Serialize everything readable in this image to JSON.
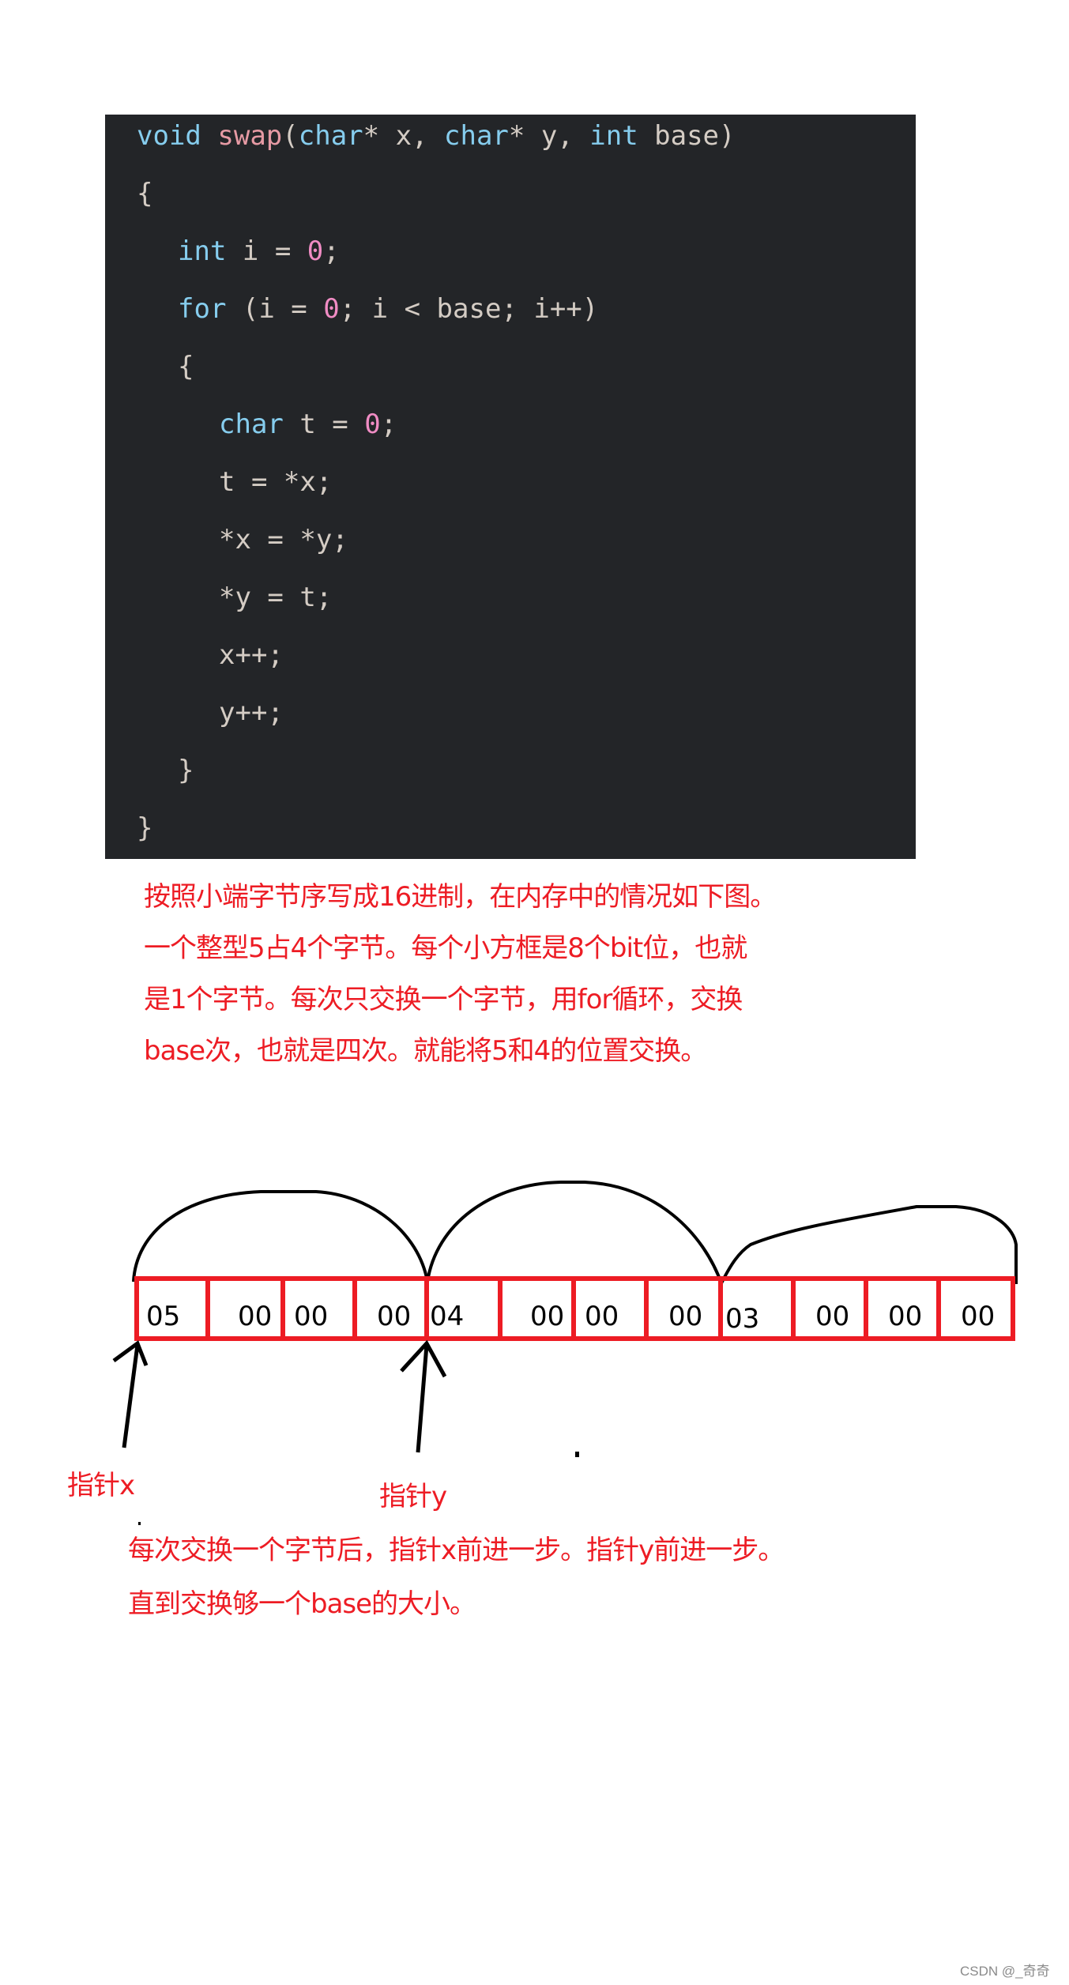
{
  "code": {
    "lines": [
      {
        "indent": 0,
        "tokens": [
          {
            "t": "void",
            "k": "kw"
          },
          {
            "t": " ",
            "k": "plain"
          },
          {
            "t": "swap",
            "k": "fn"
          },
          {
            "t": "(",
            "k": "plain"
          },
          {
            "t": "char",
            "k": "kw"
          },
          {
            "t": "* x, ",
            "k": "plain"
          },
          {
            "t": "char",
            "k": "kw"
          },
          {
            "t": "* y, ",
            "k": "plain"
          },
          {
            "t": "int",
            "k": "kw"
          },
          {
            "t": " base)",
            "k": "plain"
          }
        ]
      },
      {
        "indent": 0,
        "tokens": [
          {
            "t": "{",
            "k": "plain"
          }
        ]
      },
      {
        "indent": 1,
        "tokens": [
          {
            "t": "int",
            "k": "kw"
          },
          {
            "t": " i = ",
            "k": "plain"
          },
          {
            "t": "0",
            "k": "num"
          },
          {
            "t": ";",
            "k": "plain"
          }
        ]
      },
      {
        "indent": 1,
        "tokens": [
          {
            "t": "for",
            "k": "kw"
          },
          {
            "t": " (i = ",
            "k": "plain"
          },
          {
            "t": "0",
            "k": "num"
          },
          {
            "t": "; i < base; i++)",
            "k": "plain"
          }
        ]
      },
      {
        "indent": 1,
        "tokens": [
          {
            "t": "{",
            "k": "plain"
          }
        ]
      },
      {
        "indent": 2,
        "tokens": [
          {
            "t": "char",
            "k": "kw"
          },
          {
            "t": " t = ",
            "k": "plain"
          },
          {
            "t": "0",
            "k": "num"
          },
          {
            "t": ";",
            "k": "plain"
          }
        ]
      },
      {
        "indent": 2,
        "tokens": [
          {
            "t": "t = *x;",
            "k": "plain"
          }
        ]
      },
      {
        "indent": 2,
        "tokens": [
          {
            "t": "*x = *y;",
            "k": "plain"
          }
        ]
      },
      {
        "indent": 2,
        "tokens": [
          {
            "t": "*y = t;",
            "k": "plain"
          }
        ]
      },
      {
        "indent": 2,
        "tokens": [
          {
            "t": "x++;",
            "k": "plain"
          }
        ]
      },
      {
        "indent": 2,
        "tokens": [
          {
            "t": "y++;",
            "k": "plain"
          }
        ]
      },
      {
        "indent": 1,
        "tokens": [
          {
            "t": "}",
            "k": "plain"
          }
        ]
      },
      {
        "indent": 0,
        "tokens": [
          {
            "t": "}",
            "k": "plain"
          }
        ]
      }
    ]
  },
  "explanation": {
    "lines": [
      "按照小端字节序写成16进制，在内存中的情况如下图。",
      "一个整型5占4个字节。每个小方框是8个bit位，也就",
      "是1个字节。每次只交换一个字节，用for循环，交换",
      "base次，也就是四次。就能将5和4的位置交换。"
    ]
  },
  "memory": {
    "bytes": [
      "05",
      "00",
      "00",
      "00",
      "04",
      "00",
      "00",
      "00",
      "03",
      "00",
      "00",
      "00"
    ],
    "groups": [
      {
        "value": 5,
        "bytes": [
          "05",
          "00",
          "00",
          "00"
        ]
      },
      {
        "value": 4,
        "bytes": [
          "04",
          "00",
          "00",
          "00"
        ]
      },
      {
        "value": 3,
        "bytes": [
          "03",
          "00",
          "00",
          "00"
        ]
      }
    ],
    "pointer_x_label": "指针x",
    "pointer_y_label": "指针y",
    "colors": {
      "box": "#ed1c24",
      "annotation": "#ed1c24",
      "stroke": "#000000"
    }
  },
  "summary": {
    "lines": [
      "每次交换一个字节后，指针x前进一步。指针y前进一步。",
      "直到交换够一个base的大小。"
    ]
  },
  "watermark": "CSDN @_奇奇"
}
